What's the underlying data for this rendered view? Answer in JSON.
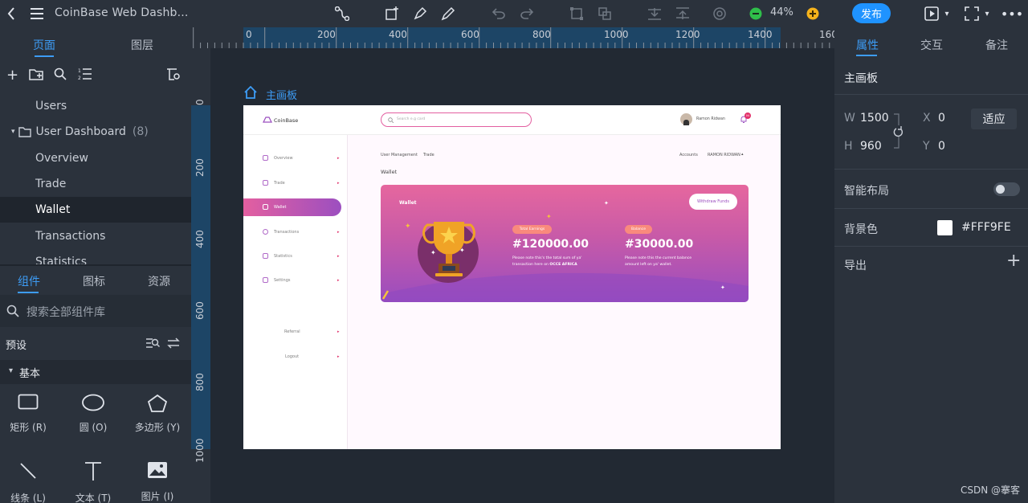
{
  "topbar": {
    "title": "CoinBase Web Dashb...",
    "zoom": "44%",
    "publish": "发布"
  },
  "left": {
    "tabs": [
      "页面",
      "图层"
    ],
    "pages": [
      "Users",
      "User Dashboard",
      "(8)",
      "Overview",
      "Trade",
      "Wallet",
      "Transactions",
      "Statistics"
    ],
    "lower_tabs": [
      "组件",
      "图标",
      "资源"
    ],
    "search_placeholder": "搜索全部组件库",
    "preset": "预设",
    "basic": "基本",
    "components": [
      "矩形 (R)",
      "圆 (O)",
      "多边形 (Y)",
      "线条 (L)",
      "文本 (T)",
      "图片 (I)"
    ]
  },
  "right": {
    "tabs": [
      "属性",
      "交互",
      "备注"
    ],
    "artboard": "主画板",
    "w_label": "W",
    "w": "1500",
    "h_label": "H",
    "h": "960",
    "x_label": "X",
    "x": "0",
    "y_label": "Y",
    "y": "0",
    "fit": "适应",
    "smart_layout": "智能布局",
    "bg_color_label": "背景色",
    "bg_color": "#FFF9FE",
    "export": "导出"
  },
  "rulers": {
    "top": [
      "0",
      "200",
      "400",
      "600",
      "800",
      "1000",
      "1200",
      "1400",
      "160"
    ],
    "left": [
      "0",
      "200",
      "400",
      "600",
      "800",
      "1000"
    ]
  },
  "canvas": {
    "artboard_label": "主画板"
  },
  "design": {
    "brand": "CoinBase",
    "search_placeholder": "Search e.g card",
    "user": "Ramon Ridwan",
    "badge": "04",
    "nav": [
      "Overview",
      "Trade",
      "Wallet",
      "Transactions",
      "Statistics",
      "Settings"
    ],
    "nav_bottom": [
      "Referral",
      "Logout"
    ],
    "breadcrumb": [
      "User Management",
      "Trade"
    ],
    "accounts": "Accounts",
    "account_name": "RAMON RIDWAN",
    "section_title": "Wallet",
    "card_title": "Wallet",
    "withdraw": "Withdraw Funds",
    "total_earnings_label": "Total Earnings",
    "total_earnings": "#120000.00",
    "total_note_1": "Please note this's the total sum of ya'",
    "total_note_2": "transaction here on",
    "total_note_brand": "OCCE AFRICA",
    "balance_label": "Balance",
    "balance": "#30000.00",
    "balance_note_1": "Please note this the current balance",
    "balance_note_2": "amount left on ya' wallet."
  },
  "watermark": "CSDN @搴客",
  "colors": {
    "accent": "#1f93ff",
    "panel": "#2b323c",
    "canvas": "#222933",
    "artboard_bg": "#FFF9FE"
  }
}
